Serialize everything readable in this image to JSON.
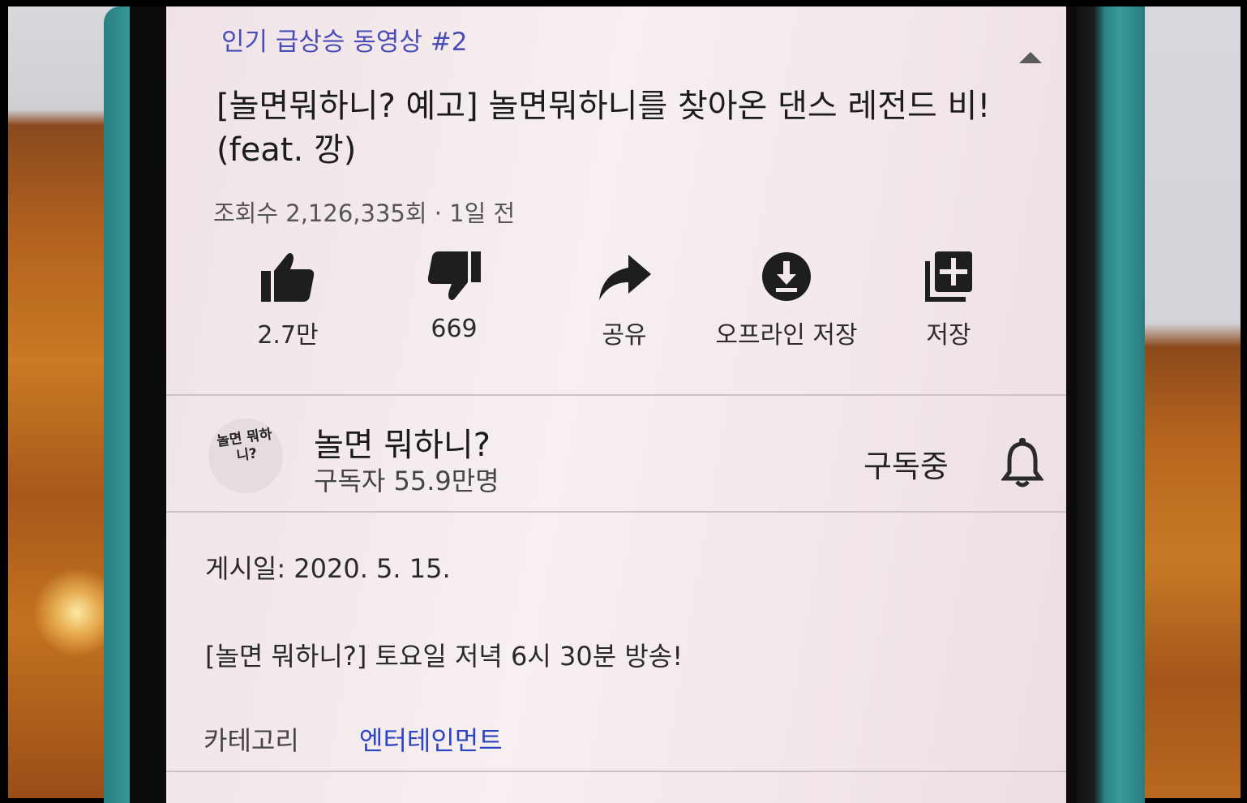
{
  "video": {
    "trending_label": "인기 급상승 동영상 #2",
    "title": "[놀면뭐하니? 예고] 놀면뭐하니를 찾아온 댄스 레전드 비! (feat. 깡)",
    "view_info": "조회수 2,126,335회 · 1일 전"
  },
  "actions": {
    "like_count": "2.7만",
    "dislike_count": "669",
    "share_label": "공유",
    "offline_label": "오프라인 저장",
    "save_label": "저장"
  },
  "channel": {
    "logo_text": "놀면 뭐하니?",
    "name": "놀면 뭐하니?",
    "subscribers": "구독자 55.9만명",
    "subscribed_label": "구독중"
  },
  "details": {
    "posted_date": "게시일: 2020. 5. 15.",
    "description": "[놀면 뭐하니?]  토요일 저녁 6시 30분 방송!",
    "category_label": "카테고리",
    "category_value": "엔터테인먼트"
  },
  "colors": {
    "link": "#2a44c4",
    "trending": "#4a4cb8",
    "phone_case": "#3a9c9c"
  }
}
